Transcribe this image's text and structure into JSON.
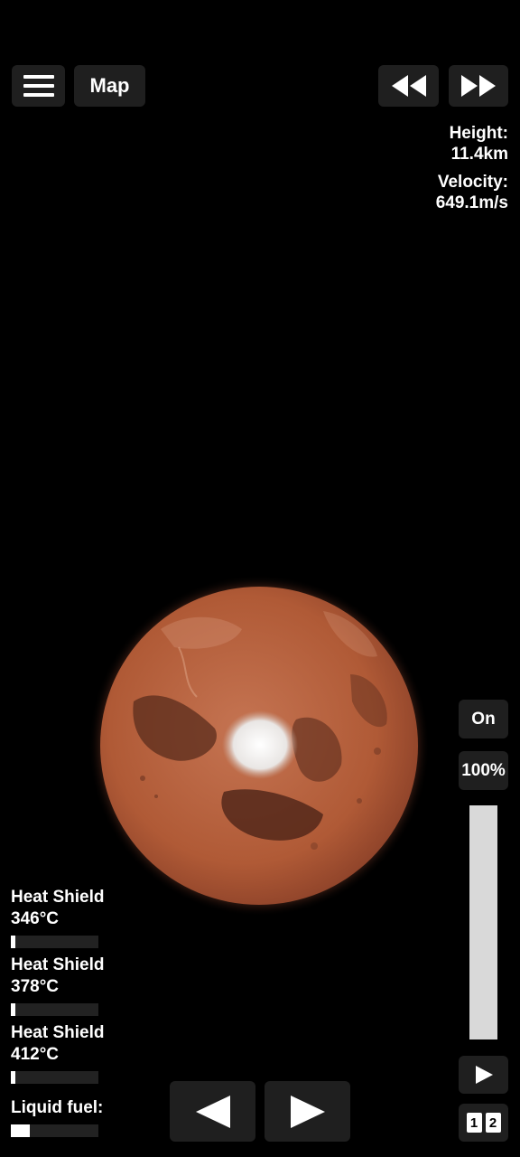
{
  "top_bar": {
    "menu_icon": "hamburger-menu-icon",
    "map_label": "Map",
    "rewind_icon": "fast-rewind-icon",
    "fast_forward_icon": "fast-forward-icon"
  },
  "telemetry": {
    "height_label": "Height:",
    "height_value": "11.4km",
    "velocity_label": "Velocity:",
    "velocity_value": "649.1m/s"
  },
  "planet": {
    "icon": "mars-planet"
  },
  "right_panel": {
    "toggle_label": "On",
    "throttle_label": "100%",
    "throttle_level": 1.0,
    "play_icon": "play-icon",
    "stage_digits": [
      "1",
      "2"
    ]
  },
  "gauges": [
    {
      "label": "Heat Shield",
      "value": "346°C",
      "level": 0.05
    },
    {
      "label": "Heat Shield",
      "value": "378°C",
      "level": 0.05
    },
    {
      "label": "Heat Shield",
      "value": "412°C",
      "level": 0.05
    },
    {
      "label": "Liquid fuel:",
      "level": 0.22
    }
  ],
  "controls": {
    "rotate_left_icon": "triangle-left-icon",
    "rotate_right_icon": "triangle-right-icon"
  },
  "colors": {
    "background": "#000000",
    "button_bg": "#1f1f1f",
    "planet_base": "#b5603a",
    "planet_dark": "#5a2c1c",
    "polar_cap": "#ececec"
  }
}
